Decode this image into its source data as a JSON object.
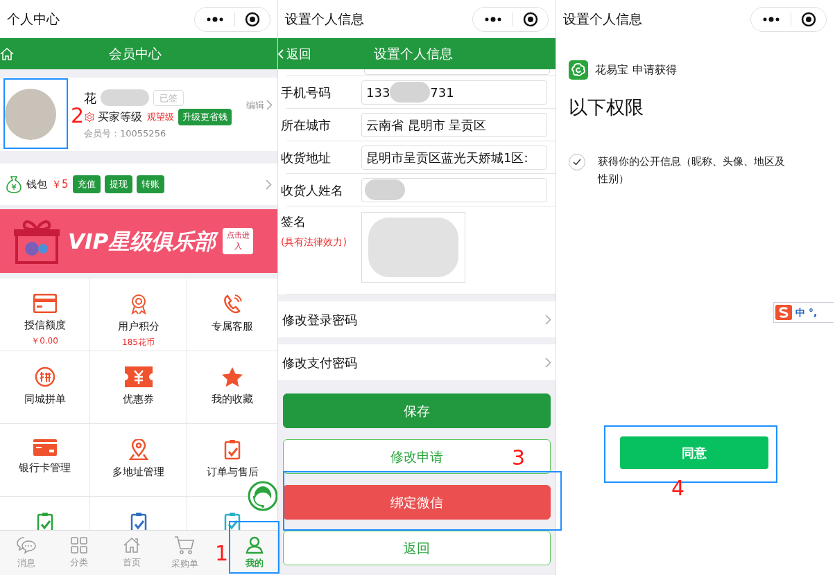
{
  "profile_screen": {
    "title": "个人中心",
    "header_title": "会员中心",
    "user": {
      "name": "花",
      "signed_badge": "已签",
      "level_label": "买家等级",
      "level_value": "观望级",
      "upgrade_button": "升级更省钱",
      "member_id_label": "会员号：",
      "member_id": "10055256",
      "edit_link": "编辑"
    },
    "wallet": {
      "label": "钱包",
      "amount": "￥5",
      "buttons": [
        "充值",
        "提现",
        "转账"
      ]
    },
    "banner": {
      "title": "VIP星级俱乐部",
      "button": "点击进入"
    },
    "grid": [
      {
        "kind": "card",
        "label": "授信额度",
        "value": "￥0.00"
      },
      {
        "kind": "medal",
        "label": "用户积分",
        "value": "185花币"
      },
      {
        "kind": "phone",
        "label": "专属客服"
      },
      {
        "kind": "group",
        "label": "同城拼单"
      },
      {
        "kind": "coupon",
        "label": "优惠券"
      },
      {
        "kind": "star",
        "label": "我的收藏"
      },
      {
        "kind": "bankcard",
        "label": "银行卡管理"
      },
      {
        "kind": "location",
        "label": "多地址管理"
      },
      {
        "kind": "clipboard",
        "label": "订单与售后",
        "color": "#f0522d"
      },
      {
        "kind": "clipboard",
        "color": "#2aa53c"
      },
      {
        "kind": "clipboard",
        "color": "#2d6fc0"
      },
      {
        "kind": "clipboard",
        "color": "#2ab0c8"
      }
    ],
    "tabbar": [
      {
        "kind": "chat",
        "label": "消息",
        "selected": false
      },
      {
        "kind": "grid",
        "label": "分类",
        "selected": false
      },
      {
        "kind": "home",
        "label": "首页",
        "selected": false
      },
      {
        "kind": "cart",
        "label": "采购单",
        "selected": false
      },
      {
        "kind": "person",
        "label": "我的",
        "selected": true
      }
    ]
  },
  "settings_screen": {
    "title": "设置个人信息",
    "back_button": "返回",
    "header_title": "设置个人信息",
    "fields": [
      {
        "kind": "masked_middle",
        "label": "手机号码",
        "value_start": "133",
        "value_end": "731"
      },
      {
        "kind": "text",
        "label": "所在城市",
        "value": "云南省 昆明市 呈贡区"
      },
      {
        "kind": "text",
        "label": "收货地址",
        "value": "昆明市呈贡区蓝光天娇城1区:"
      },
      {
        "kind": "masked",
        "label": "收货人姓名"
      },
      {
        "kind": "signature",
        "label": "签名",
        "note": "(具有法律效力)"
      }
    ],
    "links": [
      "修改登录密码",
      "修改支付密码"
    ],
    "buttons": [
      {
        "kind": "primary",
        "label": "保存"
      },
      {
        "kind": "outline",
        "label": "修改申请"
      },
      {
        "kind": "danger",
        "label": "绑定微信"
      },
      {
        "kind": "outline",
        "label": "返回"
      }
    ]
  },
  "auth_screen": {
    "title": "设置个人信息",
    "app_name": "花易宝",
    "request_text": "申请获得",
    "heading": "以下权限",
    "permissions": [
      {
        "text": "获得你的公开信息（昵称、头像、地区及性别）",
        "checked": true
      }
    ],
    "agree_button": "同意",
    "ime_bar": [
      "中",
      "°,"
    ]
  },
  "annotations": [
    {
      "number": "1"
    },
    {
      "number": "2"
    },
    {
      "number": "3"
    },
    {
      "number": "4"
    }
  ]
}
